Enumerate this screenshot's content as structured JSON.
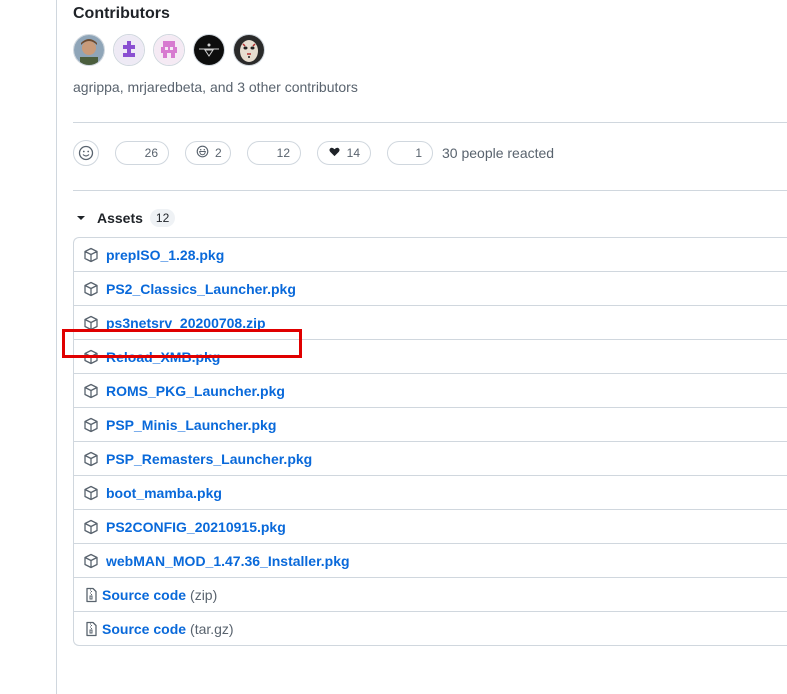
{
  "contributors": {
    "title": "Contributors",
    "summary": "agrippa, mrjaredbeta, and 3 other contributors",
    "avatars": [
      "agrippa",
      "mrjaredbeta",
      "contributor-3",
      "contributor-4",
      "contributor-5"
    ]
  },
  "reactions": {
    "counts": [
      "26",
      "2",
      "12",
      "14",
      "1"
    ],
    "emoji_icons": [
      "thumbs-up-icon",
      "smile-icon",
      "tada-icon",
      "heart-icon",
      "rocket-icon"
    ],
    "summary": "30 people reacted"
  },
  "assets": {
    "label": "Assets",
    "count": "12",
    "files": [
      "prepISO_1.28.pkg",
      "PS2_Classics_Launcher.pkg",
      "ps3netsrv_20200708.zip",
      "Reload_XMB.pkg",
      "ROMS_PKG_Launcher.pkg",
      "PSP_Minis_Launcher.pkg",
      "PSP_Remasters_Launcher.pkg",
      "boot_mamba.pkg",
      "PS2CONFIG_20210915.pkg",
      "webMAN_MOD_1.47.36_Installer.pkg"
    ],
    "source_label": "Source code",
    "source_zip": "(zip)",
    "source_targz": "(tar.gz)"
  },
  "colors": {
    "link": "#0969da",
    "highlight": "#e00000",
    "border": "#d0d7de"
  }
}
